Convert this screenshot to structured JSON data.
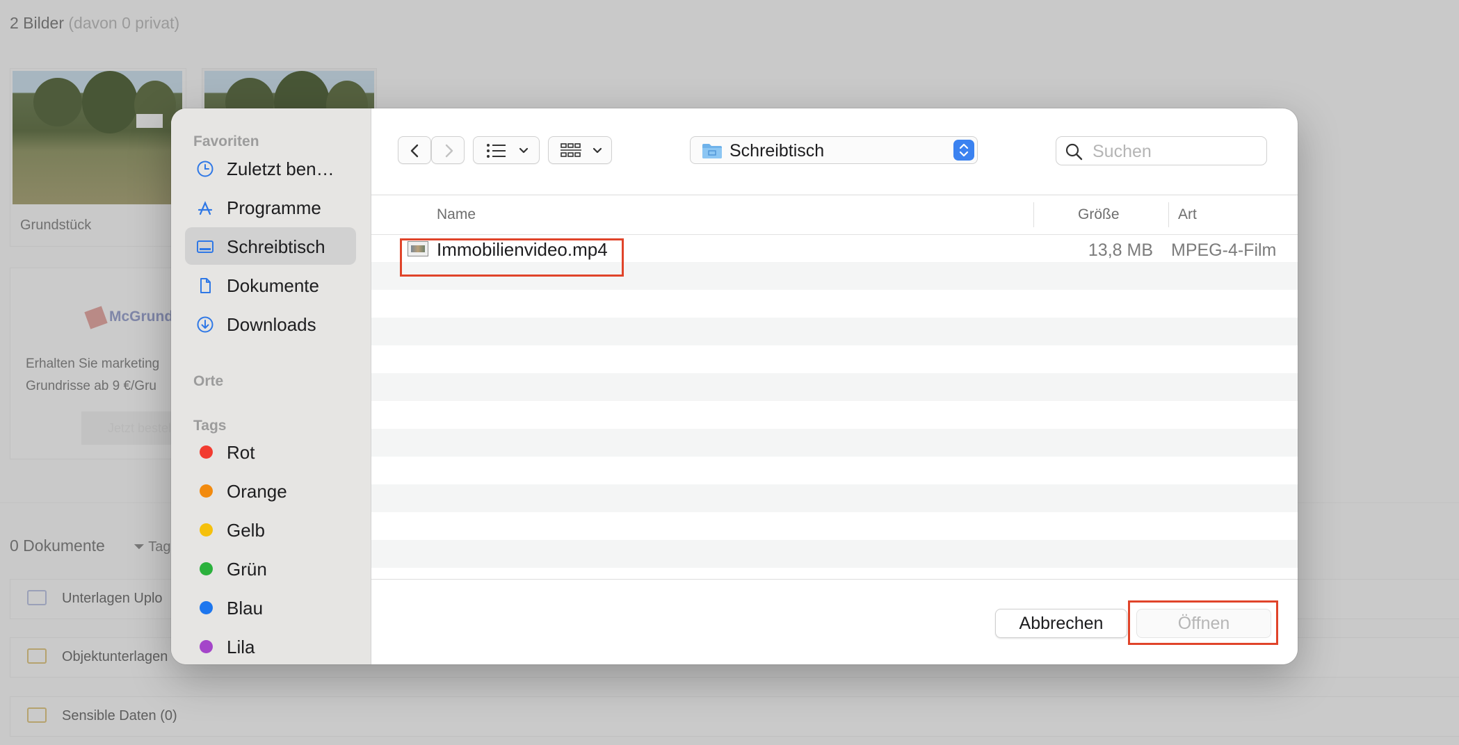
{
  "background": {
    "image_count": "2 Bilder",
    "image_count_note": "(davon 0 privat)",
    "card_label": "Grundstück",
    "promo_logo": "McGrund",
    "promo_text_line1": "Erhalten Sie marketing",
    "promo_text_line2": "Grundrisse ab 9 €/Gru",
    "promo_button": "Jetzt bestell",
    "documents_count": "0 Dokumente",
    "tags_filter": "Tag",
    "folders": [
      {
        "name": "Unterlagen Uplo"
      },
      {
        "name": "Objektunterlagen"
      },
      {
        "name": "Sensible Daten (0)"
      }
    ]
  },
  "sidebar": {
    "favorites_heading": "Favoriten",
    "favorites": [
      {
        "label": "Zuletzt ben…",
        "icon": "clock-icon"
      },
      {
        "label": "Programme",
        "icon": "apps-icon"
      },
      {
        "label": "Schreibtisch",
        "icon": "desktop-icon"
      },
      {
        "label": "Dokumente",
        "icon": "document-icon"
      },
      {
        "label": "Downloads",
        "icon": "download-icon"
      }
    ],
    "locations_heading": "Orte",
    "tags_heading": "Tags",
    "tags": [
      {
        "label": "Rot",
        "color": "#f23b30"
      },
      {
        "label": "Orange",
        "color": "#f28a0e"
      },
      {
        "label": "Gelb",
        "color": "#f5c00c"
      },
      {
        "label": "Grün",
        "color": "#2bb13c"
      },
      {
        "label": "Blau",
        "color": "#1d76ee"
      },
      {
        "label": "Lila",
        "color": "#a445c9"
      }
    ]
  },
  "toolbar": {
    "location": "Schreibtisch",
    "search_placeholder": "Suchen"
  },
  "columns": {
    "name": "Name",
    "size": "Größe",
    "kind": "Art"
  },
  "files": [
    {
      "name": "Immobilienvideo.mp4",
      "size": "13,8 MB",
      "kind": "MPEG-4-Film"
    }
  ],
  "footer": {
    "cancel": "Abbrechen",
    "open": "Öffnen"
  },
  "colors": {
    "accent": "#3b82f0",
    "highlight": "#e0442a"
  }
}
